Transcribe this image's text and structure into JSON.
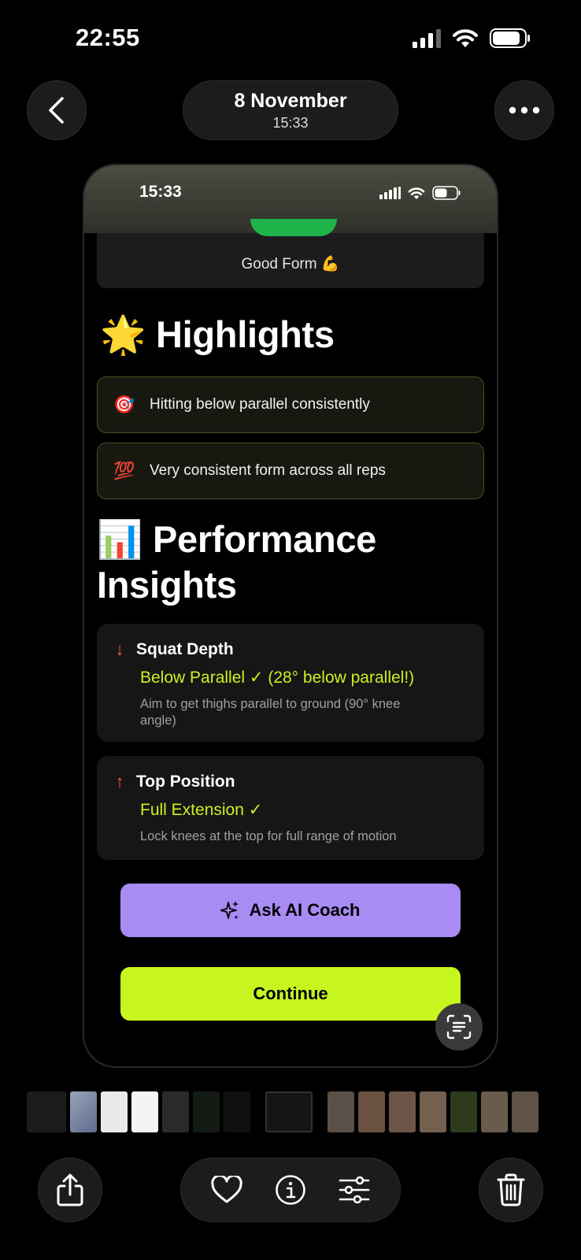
{
  "status_bar": {
    "time": "22:55"
  },
  "header": {
    "date": "8 November",
    "time": "15:33"
  },
  "embedded": {
    "status_time": "15:33",
    "score_label": "Good Form 💪",
    "highlights": {
      "title": "🌟 Highlights",
      "items": [
        {
          "emoji": "🎯",
          "text": "Hitting below parallel consistently"
        },
        {
          "emoji": "💯",
          "text": "Very consistent form across all reps"
        }
      ]
    },
    "performance": {
      "title": "📊 Performance Insights",
      "insights": [
        {
          "arrow": "↓",
          "label": "Squat Depth",
          "value": "Below Parallel ✓ (28° below parallel!)",
          "note": "Aim to get thighs parallel to ground (90° knee angle)"
        },
        {
          "arrow": "↑",
          "label": "Top Position",
          "value": "Full Extension ✓",
          "note": "Lock knees at the top for full range of motion"
        }
      ]
    },
    "ask_ai_label": "Ask AI Coach",
    "continue_label": "Continue",
    "accent_green": "#c6f51f",
    "accent_purple": "#a98bf4"
  },
  "toolbar": {
    "icons": [
      "share-icon",
      "heart-icon",
      "info-icon",
      "adjust-icon",
      "trash-icon"
    ]
  }
}
